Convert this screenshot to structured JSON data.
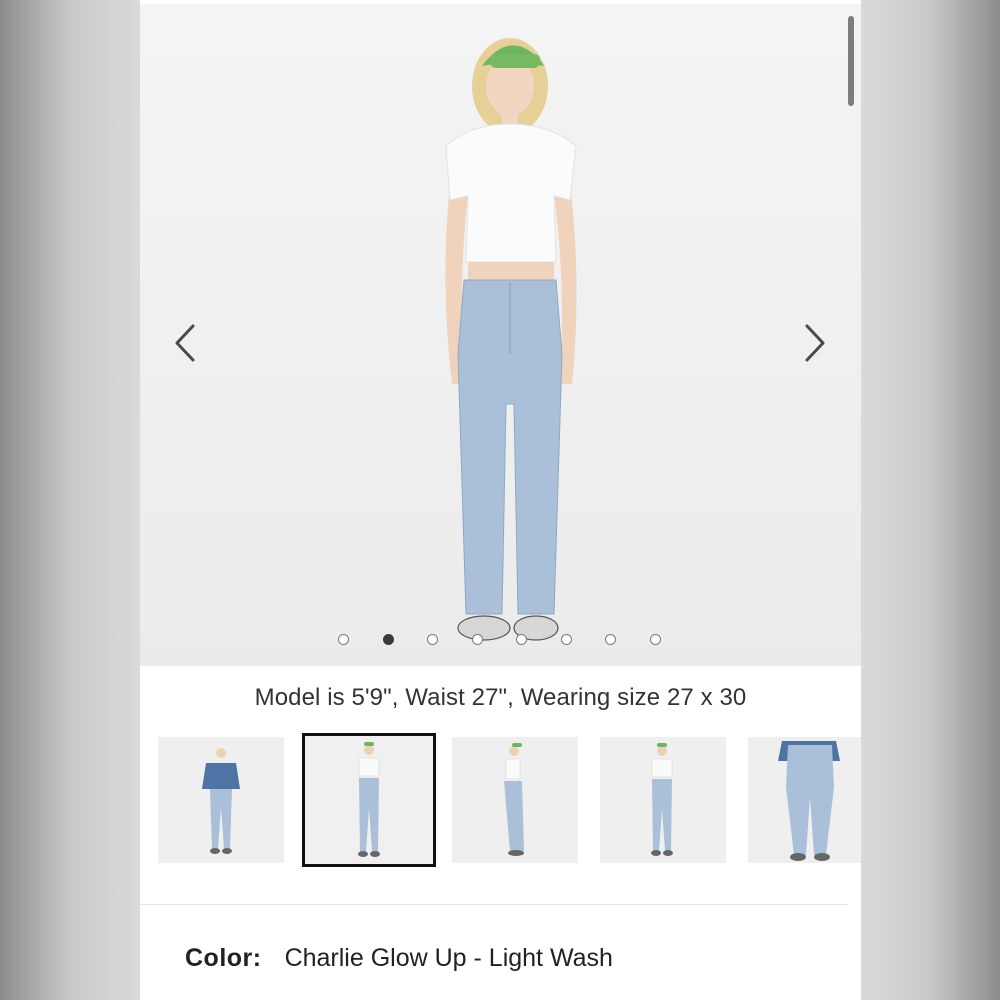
{
  "product": {
    "caption": "Model is 5'9\", Waist 27\", Wearing size 27 x 30",
    "color_label": "Color:",
    "color_value": "Charlie Glow Up - Light Wash"
  },
  "carousel": {
    "prev_icon": "chevron-left-icon",
    "next_icon": "chevron-right-icon",
    "dot_count": 8,
    "active_dot": 2
  },
  "thumbnails": {
    "count": 5,
    "selected": 2,
    "views": [
      "front-with-denim-jacket",
      "front",
      "side",
      "back",
      "front-closeup-with-jacket"
    ]
  },
  "colors": {
    "denim": "#a9c0d8",
    "cap": "#6fb55f",
    "active_dot": "#3a3a3a",
    "selected_border": "#111111"
  }
}
